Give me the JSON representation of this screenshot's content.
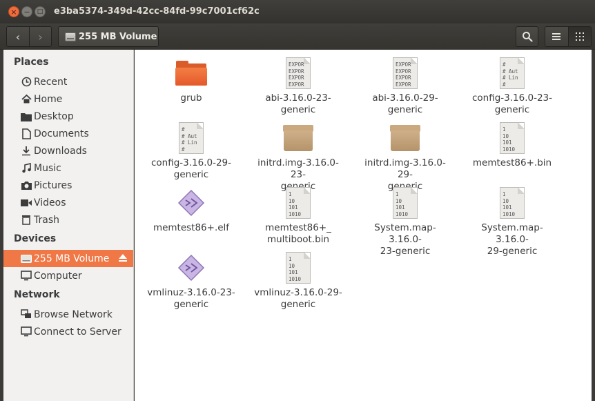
{
  "window": {
    "title": "e3ba5374-349d-42cc-84fd-99c7001cf62c"
  },
  "toolbar": {
    "path_label": "255 MB Volume"
  },
  "sidebar": {
    "sections": [
      {
        "label": "Places",
        "items": [
          {
            "label": "Recent",
            "icon": "clock-icon"
          },
          {
            "label": "Home",
            "icon": "home-icon"
          },
          {
            "label": "Desktop",
            "icon": "folder-icon"
          },
          {
            "label": "Documents",
            "icon": "document-icon"
          },
          {
            "label": "Downloads",
            "icon": "download-icon"
          },
          {
            "label": "Music",
            "icon": "music-icon"
          },
          {
            "label": "Pictures",
            "icon": "camera-icon"
          },
          {
            "label": "Videos",
            "icon": "video-icon"
          },
          {
            "label": "Trash",
            "icon": "trash-icon"
          }
        ]
      },
      {
        "label": "Devices",
        "items": [
          {
            "label": "255 MB Volume",
            "icon": "drive-icon",
            "selected": true
          },
          {
            "label": "Computer",
            "icon": "computer-icon"
          }
        ]
      },
      {
        "label": "Network",
        "items": [
          {
            "label": "Browse Network",
            "icon": "network-icon"
          },
          {
            "label": "Connect to Server",
            "icon": "server-icon"
          }
        ]
      }
    ]
  },
  "files": [
    {
      "name": "grub",
      "icon": "folder-icon"
    },
    {
      "name": "abi-3.16.0-23-\ngeneric",
      "icon": "text-export-icon"
    },
    {
      "name": "abi-3.16.0-29-\ngeneric",
      "icon": "text-export-icon"
    },
    {
      "name": "config-3.16.0-23-\ngeneric",
      "icon": "text-config-icon"
    },
    {
      "name": "config-3.16.0-29-\ngeneric",
      "icon": "text-config-icon"
    },
    {
      "name": "initrd.img-3.16.0-23-\ngeneric",
      "icon": "package-icon"
    },
    {
      "name": "initrd.img-3.16.0-29-\ngeneric",
      "icon": "package-icon"
    },
    {
      "name": "memtest86+.bin",
      "icon": "binary-icon"
    },
    {
      "name": "memtest86+.elf",
      "icon": "executable-icon"
    },
    {
      "name": "memtest86+_\nmultiboot.bin",
      "icon": "binary-icon"
    },
    {
      "name": "System.map-3.16.0-\n23-generic",
      "icon": "binary-icon"
    },
    {
      "name": "System.map-3.16.0-\n29-generic",
      "icon": "binary-icon"
    },
    {
      "name": "vmlinuz-3.16.0-23-\ngeneric",
      "icon": "executable-icon"
    },
    {
      "name": "vmlinuz-3.16.0-29-\ngeneric",
      "icon": "binary-icon"
    }
  ],
  "icon_text": {
    "export": "EXPOR\nEXPOR\nEXPOR\nEXPOR",
    "config": "#\n# Aut\n# Lin\n#",
    "binary": "1\n10\n101\n1010"
  },
  "colors": {
    "accent": "#f07746",
    "titlebar": "#3c3b37",
    "folder": "#e4592a"
  }
}
